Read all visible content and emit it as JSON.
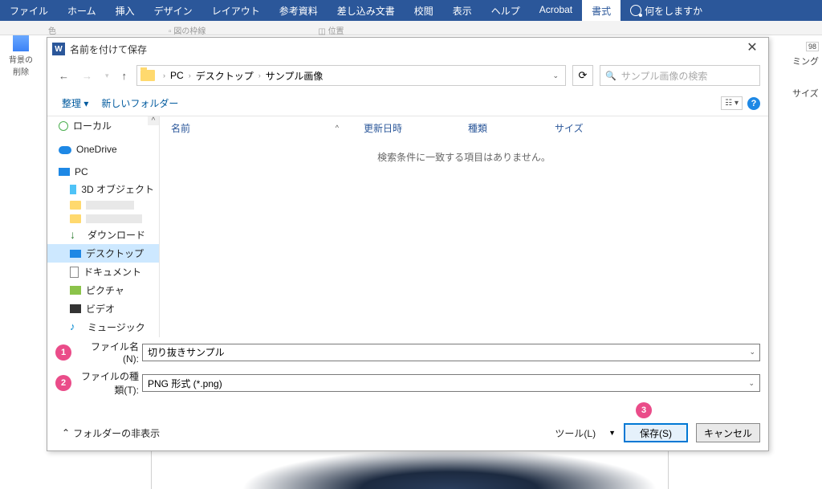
{
  "ribbon": {
    "tabs": [
      "ファイル",
      "ホーム",
      "挿入",
      "デザイン",
      "レイアウト",
      "参考資料",
      "差し込み文書",
      "校閲",
      "表示",
      "ヘルプ",
      "Acrobat",
      "書式"
    ],
    "active_tab": "書式",
    "tell_me": "何をしますか"
  },
  "bg_sidebar": {
    "label": "背景の\n削除"
  },
  "right_stub": {
    "line1": "ミング",
    "line2": "サイズ",
    "badge": "98"
  },
  "dialog": {
    "title": "名前を付けて保存",
    "path": {
      "root": "PC",
      "level1": "デスクトップ",
      "level2": "サンプル画像"
    },
    "search_placeholder": "サンプル画像の検索",
    "toolbar": {
      "organize": "整理",
      "new_folder": "新しいフォルダー"
    },
    "columns": {
      "name": "名前",
      "date": "更新日時",
      "type": "種類",
      "size": "サイズ"
    },
    "empty": "検索条件に一致する項目はありません。",
    "tree": {
      "local": "ローカル",
      "onedrive": "OneDrive",
      "pc": "PC",
      "obj3d": "3D オブジェクト",
      "downloads": "ダウンロード",
      "desktop": "デスクトップ",
      "documents": "ドキュメント",
      "pictures": "ピクチャ",
      "videos": "ビデオ",
      "music": "ミュージック"
    },
    "filename_label": "ファイル名(N):",
    "filename_value": "切り抜きサンプル",
    "filetype_label": "ファイルの種類(T):",
    "filetype_value": "PNG 形式 (*.png)",
    "hide_folders": "フォルダーの非表示",
    "tools": "ツール(L)",
    "save": "保存(S)",
    "cancel": "キャンセル",
    "badges": {
      "one": "1",
      "two": "2",
      "three": "3"
    }
  },
  "ribbon_partial": {
    "color": "色",
    "wrap": "図の枠線",
    "pos": "位置"
  }
}
